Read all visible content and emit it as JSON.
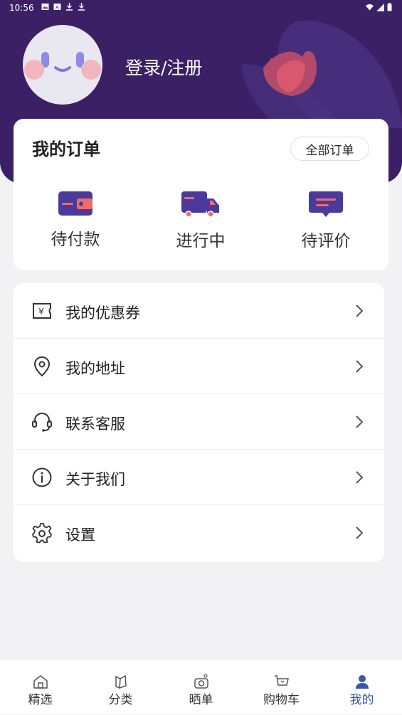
{
  "status_bar": {
    "time": "10:56"
  },
  "header": {
    "login_label": "登录/注册",
    "colors": {
      "background": "#3b2066",
      "accent": "#4a3a9c",
      "highlight": "#f36a6a"
    }
  },
  "orders": {
    "title": "我的订单",
    "all_orders_label": "全部订单",
    "items": [
      {
        "label": "待付款",
        "icon": "wallet-icon"
      },
      {
        "label": "进行中",
        "icon": "truck-icon"
      },
      {
        "label": "待评价",
        "icon": "comment-icon"
      }
    ]
  },
  "menu": {
    "items": [
      {
        "label": "我的优惠券",
        "icon": "coupon-icon"
      },
      {
        "label": "我的地址",
        "icon": "location-icon"
      },
      {
        "label": "联系客服",
        "icon": "headset-icon"
      },
      {
        "label": "关于我们",
        "icon": "info-icon"
      },
      {
        "label": "设置",
        "icon": "settings-gear-icon"
      }
    ]
  },
  "bottom_nav": {
    "items": [
      {
        "label": "精选",
        "icon": "home-icon",
        "active": false
      },
      {
        "label": "分类",
        "icon": "category-icon",
        "active": false
      },
      {
        "label": "晒单",
        "icon": "camera-icon",
        "active": false
      },
      {
        "label": "购物车",
        "icon": "cart-icon",
        "active": false
      },
      {
        "label": "我的",
        "icon": "user-icon",
        "active": true
      }
    ],
    "active_color": "#3a55b8"
  }
}
